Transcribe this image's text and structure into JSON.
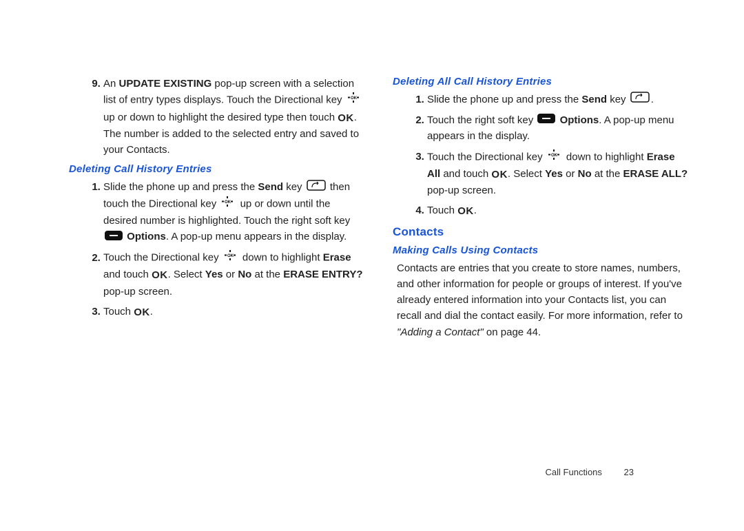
{
  "left": {
    "step9": {
      "num": "9.",
      "t1": "An ",
      "b1": "UPDATE EXISTING",
      "t2": " pop-up screen with a selection list of entry types displays. Touch the Directional key ",
      "t3": " up or down to highlight the desired type then touch ",
      "t4": ". The number is added to the selected entry and saved to your Contacts."
    },
    "h1": "Deleting Call History Entries",
    "s1": {
      "t1": "Slide the phone up and press the ",
      "b1": "Send",
      "t2": " key ",
      "t3": " then touch the Directional key ",
      "t4": " up or down until the desired number is highlighted. Touch the right soft key ",
      "b2": "Options",
      "t5": ". A pop-up menu appears in the display."
    },
    "s2": {
      "t1": "Touch the Directional key ",
      "t2": " down to highlight ",
      "b1": "Erase",
      "t3": " and touch ",
      "t4": ". Select ",
      "b2": "Yes",
      "t5": " or ",
      "b3": "No",
      "t6": " at the ",
      "b4": "ERASE ENTRY?",
      "t7": " pop-up screen."
    },
    "s3": {
      "t1": "Touch ",
      "t2": "."
    }
  },
  "right": {
    "h1": "Deleting All Call History Entries",
    "s1": {
      "t1": "Slide the phone up and press the ",
      "b1": "Send",
      "t2": " key ",
      "t3": "."
    },
    "s2": {
      "t1": "Touch the right soft key ",
      "b1": "Options",
      "t2": ". A pop-up menu appears in the display."
    },
    "s3": {
      "t1": "Touch the Directional key ",
      "t2": " down to highlight ",
      "b1": "Erase All",
      "t3": " and touch ",
      "t4": ". Select ",
      "b2": "Yes",
      "t5": " or ",
      "b3": "No",
      "t6": " at the ",
      "b4": "ERASE ALL?",
      "t7": " pop-up screen."
    },
    "s4": {
      "t1": "Touch ",
      "t2": "."
    },
    "h2": "Contacts",
    "h3": "Making Calls Using Contacts",
    "p": {
      "t1": "Contacts are entries that you create to store names, numbers, and other information for people or groups of interest. If you've already entered information into your Contacts list, you can recall and dial the contact easily. For more information, refer to ",
      "i1": "\"Adding a Contact\"",
      "t2": " on page 44."
    }
  },
  "footer": {
    "section": "Call Functions",
    "page": "23"
  },
  "ok": "OK"
}
